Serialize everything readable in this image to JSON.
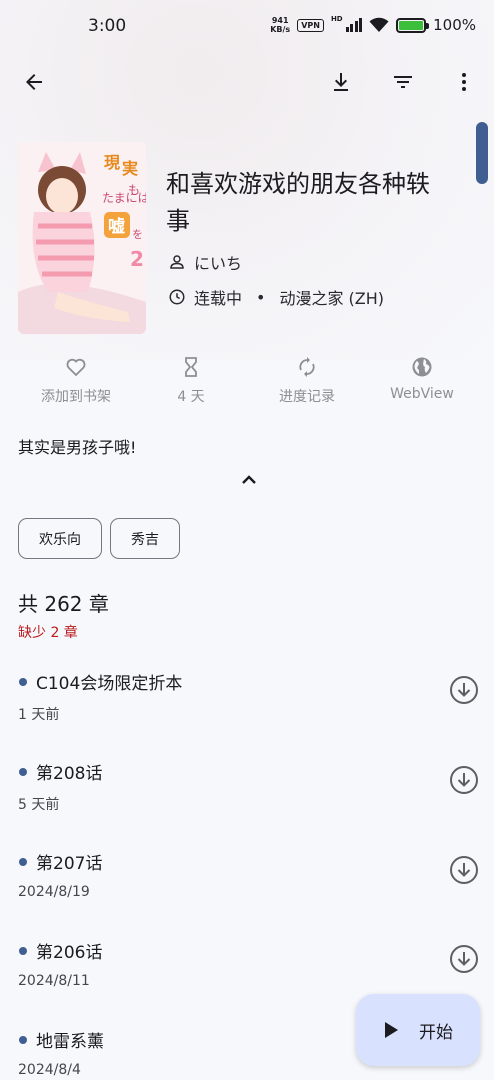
{
  "status_bar": {
    "time": "3:00",
    "net_speed_value": "941",
    "net_speed_unit": "KB/s",
    "vpn": "VPN",
    "hd": "HD",
    "battery": "100%"
  },
  "toolbar": {
    "back_icon": "arrow-back",
    "download_icon": "download",
    "filter_icon": "filter",
    "more_icon": "more-vertical"
  },
  "manga": {
    "title_line1": "和喜欢游戏的朋友各种轶",
    "title_line2": "事",
    "author": "にいち",
    "status": "连载中",
    "separator": "•",
    "source": "动漫之家 (ZH)"
  },
  "actions": [
    {
      "label": "添加到书架",
      "icon": "heart"
    },
    {
      "label": "4 天",
      "icon": "hourglass"
    },
    {
      "label": "进度记录",
      "icon": "sync"
    },
    {
      "label": "WebView",
      "icon": "globe"
    }
  ],
  "description": "其实是男孩子哦!",
  "tags": [
    "欢乐向",
    "秀吉"
  ],
  "chapters_summary": {
    "count": "共 262 章",
    "missing": "缺少 2 章"
  },
  "chapters": [
    {
      "name": "C104会场限定折本",
      "date": "1 天前"
    },
    {
      "name": "第208话",
      "date": "5 天前"
    },
    {
      "name": "第207话",
      "date": "2024/8/19"
    },
    {
      "name": "第206话",
      "date": "2024/8/11"
    },
    {
      "name": "地雷系薰",
      "date": "2024/8/4"
    }
  ],
  "fab": {
    "label": "开始",
    "icon": "play"
  },
  "colors": {
    "accent": "#3f5f92",
    "fab_bg": "#d8e2ff",
    "missing_text": "#ba1a1a",
    "background": "#f7f8fc"
  }
}
